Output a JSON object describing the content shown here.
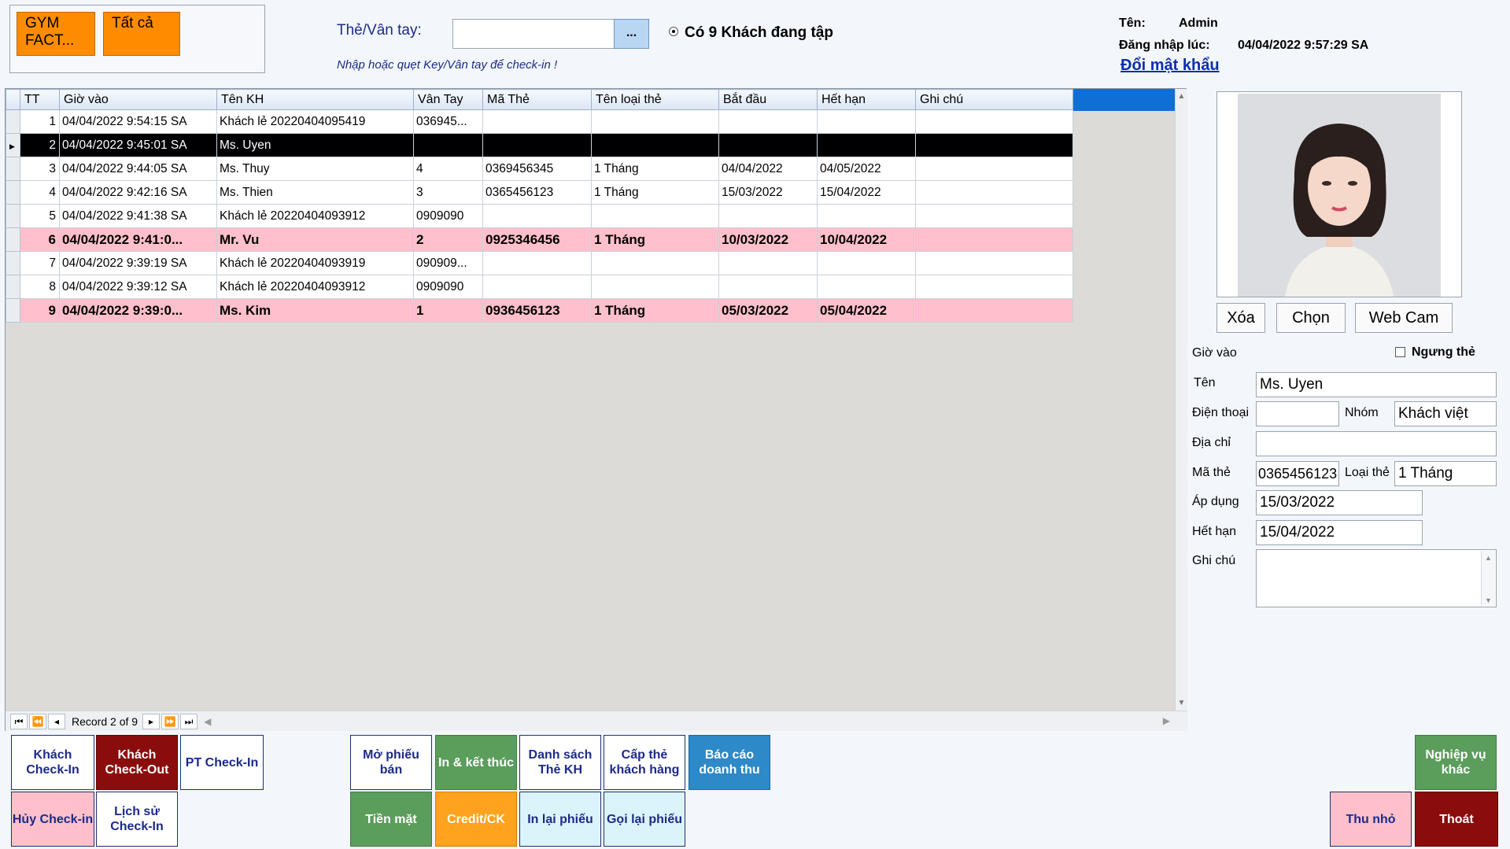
{
  "top": {
    "gym_button": "GYM FACT...",
    "all_button": "Tất cả",
    "card_label": "Thẻ/Vân tay:",
    "card_input_value": "",
    "browse_button": "...",
    "active_status": "Có 9 Khách đang tập",
    "hint": "Nhập hoặc quẹt Key/Vân tay để check-in !",
    "user_label": "Tên:",
    "user_value": "Admin",
    "login_label": "Đăng nhập lúc:",
    "login_value": "04/04/2022 9:57:29 SA",
    "change_password": "Đổi mật khẩu"
  },
  "grid": {
    "columns": [
      "TT",
      "Giờ vào",
      "Tên KH",
      "Vân Tay",
      "Mã Thẻ",
      "Tên loại thẻ",
      "Bắt đầu",
      "Hết hạn",
      "Ghi chú"
    ],
    "rows": [
      {
        "tt": "1",
        "gio_vao": "04/04/2022 9:54:15 SA",
        "ten_kh": "Khách lẻ 20220404095419",
        "van_tay": "036945...",
        "ma_the": "",
        "loai_the": "",
        "bat_dau": "",
        "het_han": "",
        "ghi_chu": "",
        "style": "normal"
      },
      {
        "tt": "2",
        "gio_vao": "04/04/2022 9:45:01 SA",
        "ten_kh": "Ms. Uyen",
        "van_tay": "",
        "ma_the": "",
        "loai_the": "",
        "bat_dau": "",
        "het_han": "",
        "ghi_chu": "",
        "style": "current"
      },
      {
        "tt": "3",
        "gio_vao": "04/04/2022 9:44:05 SA",
        "ten_kh": "Ms. Thuy",
        "van_tay": "4",
        "ma_the": "0369456345",
        "loai_the": "1 Tháng",
        "bat_dau": "04/04/2022",
        "het_han": "04/05/2022",
        "ghi_chu": "",
        "style": "normal"
      },
      {
        "tt": "4",
        "gio_vao": "04/04/2022 9:42:16 SA",
        "ten_kh": "Ms. Thien",
        "van_tay": "3",
        "ma_the": "0365456123",
        "loai_the": "1 Tháng",
        "bat_dau": "15/03/2022",
        "het_han": "15/04/2022",
        "ghi_chu": "",
        "style": "normal"
      },
      {
        "tt": "5",
        "gio_vao": "04/04/2022 9:41:38 SA",
        "ten_kh": "Khách lẻ 20220404093912",
        "van_tay": "0909090",
        "ma_the": "",
        "loai_the": "",
        "bat_dau": "",
        "het_han": "",
        "ghi_chu": "",
        "style": "normal"
      },
      {
        "tt": "6",
        "gio_vao": "04/04/2022 9:41:0...",
        "ten_kh": "Mr. Vu",
        "van_tay": "2",
        "ma_the": "0925346456",
        "loai_the": "1 Tháng",
        "bat_dau": "10/03/2022",
        "het_han": "10/04/2022",
        "ghi_chu": "",
        "style": "pink"
      },
      {
        "tt": "7",
        "gio_vao": "04/04/2022 9:39:19 SA",
        "ten_kh": "Khách lẻ 20220404093919",
        "van_tay": "090909...",
        "ma_the": "",
        "loai_the": "",
        "bat_dau": "",
        "het_han": "",
        "ghi_chu": "",
        "style": "normal"
      },
      {
        "tt": "8",
        "gio_vao": "04/04/2022 9:39:12 SA",
        "ten_kh": "Khách lẻ 20220404093912",
        "van_tay": "0909090",
        "ma_the": "",
        "loai_the": "",
        "bat_dau": "",
        "het_han": "",
        "ghi_chu": "",
        "style": "normal"
      },
      {
        "tt": "9",
        "gio_vao": "04/04/2022 9:39:0...",
        "ten_kh": "Ms. Kim",
        "van_tay": "1",
        "ma_the": "0936456123",
        "loai_the": "1 Tháng",
        "bat_dau": "05/03/2022",
        "het_han": "05/04/2022",
        "ghi_chu": "",
        "style": "pink"
      }
    ],
    "record_text": "Record 2 of 9"
  },
  "detail": {
    "delete_button": "Xóa",
    "choose_button": "Chọn",
    "webcam_button": "Web Cam",
    "checkin_label": "Giờ vào",
    "stop_card_label": "Ngưng thẻ",
    "name_label": "Tên",
    "name_value": "Ms. Uyen",
    "phone_label": "Điện thoại",
    "phone_value": "",
    "group_label": "Nhóm",
    "group_value": "Khách việt",
    "address_label": "Địa chỉ",
    "address_value": "",
    "card_code_label": "Mã thẻ",
    "card_code_value": "0365456123",
    "card_type_label": "Loại thẻ",
    "card_type_value": "1 Tháng",
    "apply_label": "Áp dụng",
    "apply_value": "15/03/2022",
    "expire_label": "Hết hạn",
    "expire_value": "15/04/2022",
    "note_label": "Ghi chú",
    "note_value": ""
  },
  "buttons": {
    "checkin": "Khách Check-In",
    "checkout": "Khách Check-Out",
    "pt_checkin": "PT Check-In",
    "cancel_checkin": "Hủy Check-in",
    "history_checkin": "Lịch sử Check-In",
    "open_ticket": "Mở phiếu bán",
    "print_finish": "In & kết thúc",
    "card_list": "Danh sách Thẻ KH",
    "issue_card": "Cấp thẻ khách hàng",
    "revenue_report": "Báo cáo doanh thu",
    "cash": "Tiền mặt",
    "credit": "Credit/CK",
    "reprint": "In lại phiếu",
    "recall": "Gọi lại phiếu",
    "other_ops": "Nghiệp vụ khác",
    "minimize": "Thu nhỏ",
    "exit": "Thoát"
  },
  "colors": {
    "orange": "#ff8c00",
    "pink_row": "#ffc0cb",
    "selected_row": "#000000",
    "header_blue": "#0f6fd6",
    "exit_red": "#8b0c0c"
  }
}
